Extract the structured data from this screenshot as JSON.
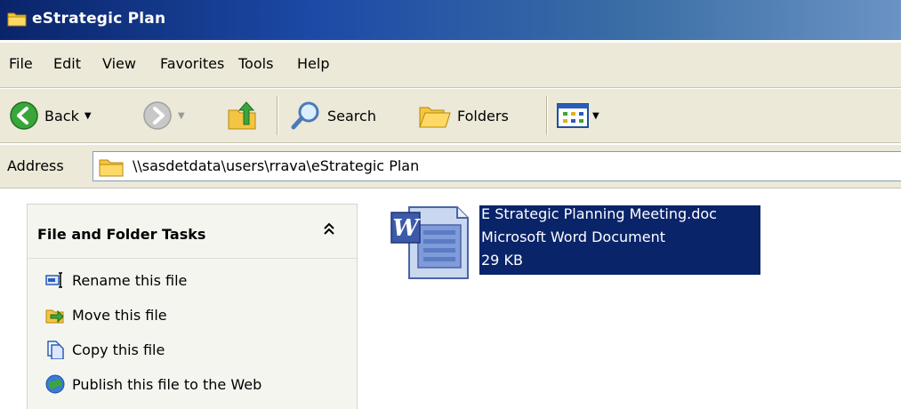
{
  "window": {
    "title": "eStrategic Plan"
  },
  "menu": [
    "File",
    "Edit",
    "View",
    "Favorites",
    "Tools",
    "Help"
  ],
  "toolbar": {
    "back": "Back",
    "search": "Search",
    "folders": "Folders"
  },
  "address": {
    "label": "Address",
    "path": "\\\\sasdetdata\\users\\rrava\\eStrategic Plan"
  },
  "taskpane": {
    "title": "File and Folder Tasks",
    "items": [
      "Rename this file",
      "Move this file",
      "Copy this file",
      "Publish this file to the Web"
    ]
  },
  "file": {
    "name": "E Strategic Planning Meeting.doc",
    "type": "Microsoft Word Document",
    "size": "29 KB"
  },
  "colors": {
    "titlebar": "#0a246a",
    "chrome": "#ece9d8",
    "selection": "#0a246a"
  }
}
